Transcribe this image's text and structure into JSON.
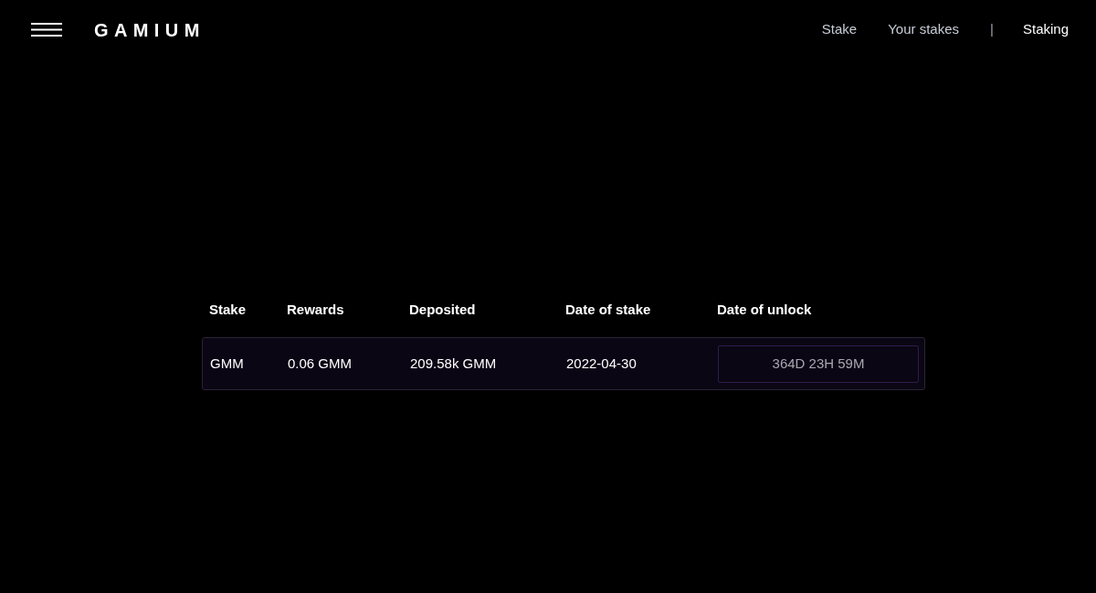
{
  "header": {
    "logo": "GAMIUM",
    "nav_links": [
      "Stake",
      "Your stakes"
    ],
    "separator": "|",
    "app_link": "Staking"
  },
  "table": {
    "columns": [
      "Stake",
      "Rewards",
      "Deposited",
      "Date of stake",
      "Date of unlock"
    ],
    "rows": [
      {
        "stake": "GMM",
        "rewards": "0.06 GMM",
        "deposited": "209.58k GMM",
        "date_of_stake": "2022-04-30",
        "unlock_countdown": "364D 23H 59M"
      }
    ]
  }
}
